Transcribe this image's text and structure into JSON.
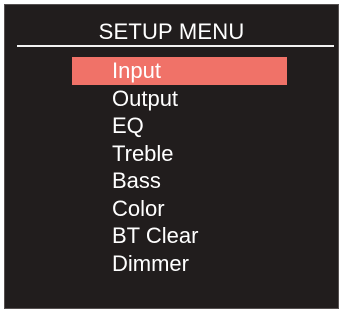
{
  "title": "SETUP MENU",
  "menu": {
    "selected_index": 0,
    "highlight_color": "#f07268",
    "items": [
      {
        "label": "Input"
      },
      {
        "label": "Output"
      },
      {
        "label": "EQ"
      },
      {
        "label": "Treble"
      },
      {
        "label": "Bass"
      },
      {
        "label": "Color"
      },
      {
        "label": "BT Clear"
      },
      {
        "label": "Dimmer"
      }
    ]
  }
}
